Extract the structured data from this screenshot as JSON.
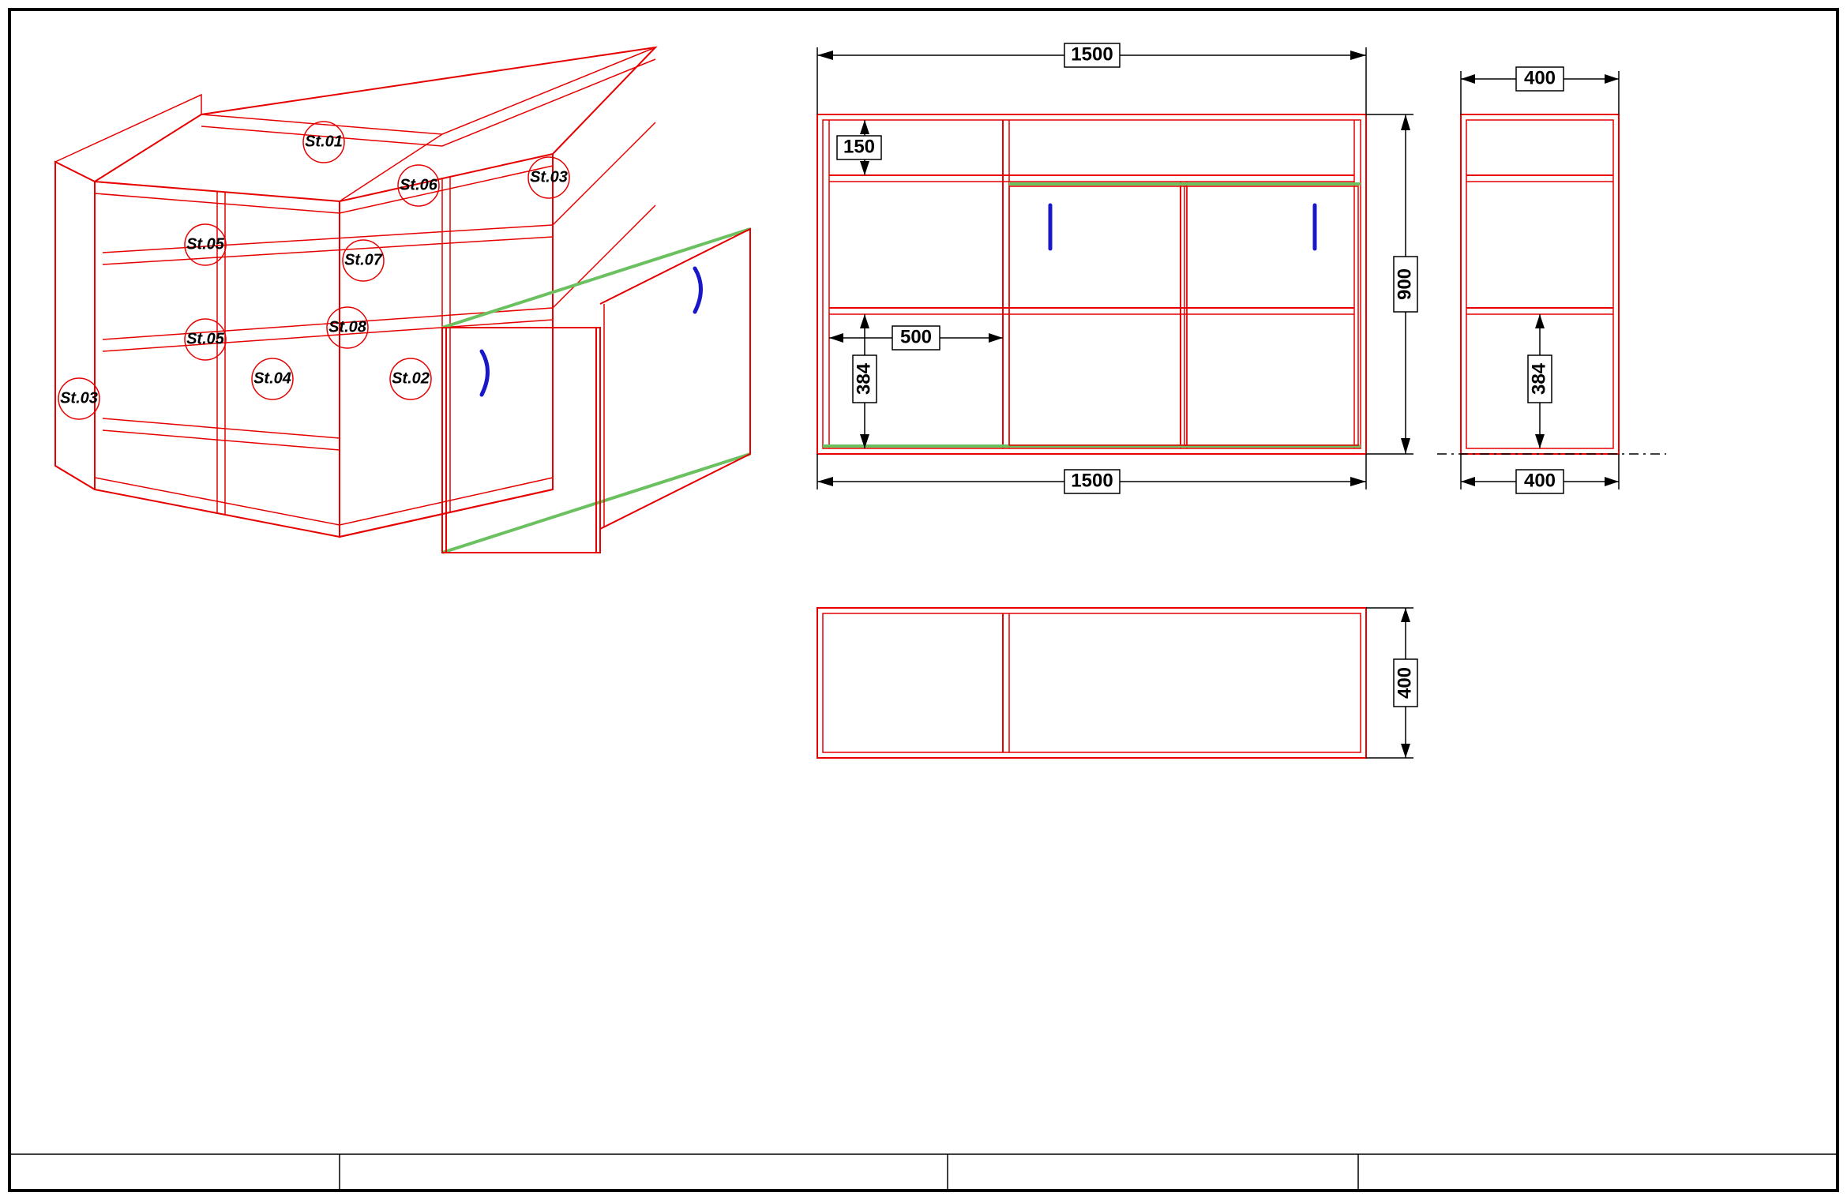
{
  "balloons": {
    "b1": "St.01",
    "b2": "St.02",
    "b3a": "St.03",
    "b3b": "St.03",
    "b4": "St.04",
    "b5a": "St.05",
    "b5b": "St.05",
    "b6": "St.06",
    "b7": "St.07",
    "b8": "St.08"
  },
  "dims": {
    "front_top": "1500",
    "front_bottom": "1500",
    "front_height": "900",
    "front_shelf": "150",
    "front_col": "500",
    "front_low": "384",
    "side_top": "400",
    "side_bottom": "400",
    "side_low": "384",
    "top_height": "400"
  }
}
